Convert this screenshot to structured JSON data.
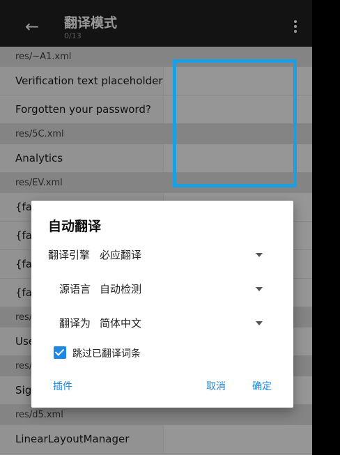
{
  "appbar": {
    "title": "翻译模式",
    "subtitle": "0/13"
  },
  "list": [
    {
      "kind": "file",
      "text": "res/~A1.xml"
    },
    {
      "kind": "str",
      "text": "Verification text placeholder"
    },
    {
      "kind": "str",
      "text": "Forgotten your password?"
    },
    {
      "kind": "file",
      "text": "res/5C.xml"
    },
    {
      "kind": "str",
      "text": "Analytics"
    },
    {
      "kind": "file",
      "text": "res/EV.xml"
    },
    {
      "kind": "str",
      "text": "{fa"
    },
    {
      "kind": "str",
      "text": "{fa"
    },
    {
      "kind": "str",
      "text": "{fa"
    },
    {
      "kind": "str",
      "text": "{fa"
    },
    {
      "kind": "file",
      "text": "res/"
    },
    {
      "kind": "str",
      "text": "Use"
    },
    {
      "kind": "file",
      "text": "res/"
    },
    {
      "kind": "str",
      "text": "Sigr"
    },
    {
      "kind": "file",
      "text": "res/d5.xml"
    },
    {
      "kind": "str",
      "text": "LinearLayoutManager"
    }
  ],
  "dialog": {
    "title": "自动翻译",
    "engine_label": "翻译引擎",
    "engine_value": "必应翻译",
    "source_label": "源语言",
    "source_value": "自动检测",
    "target_label": "翻译为",
    "target_value": "简体中文",
    "skip_label": "跳过已翻译词条",
    "skip_checked": true,
    "plugin_button": "插件",
    "cancel_button": "取消",
    "ok_button": "确定"
  },
  "colors": {
    "accent": "#1e88e5",
    "highlight": "#1a9fe0",
    "appbar": "#212121"
  },
  "icons": {
    "back": "arrow-back-icon",
    "more": "more-vert-icon",
    "dropdown": "dropdown-arrow-icon",
    "checkbox": "checkbox-checked-icon"
  }
}
